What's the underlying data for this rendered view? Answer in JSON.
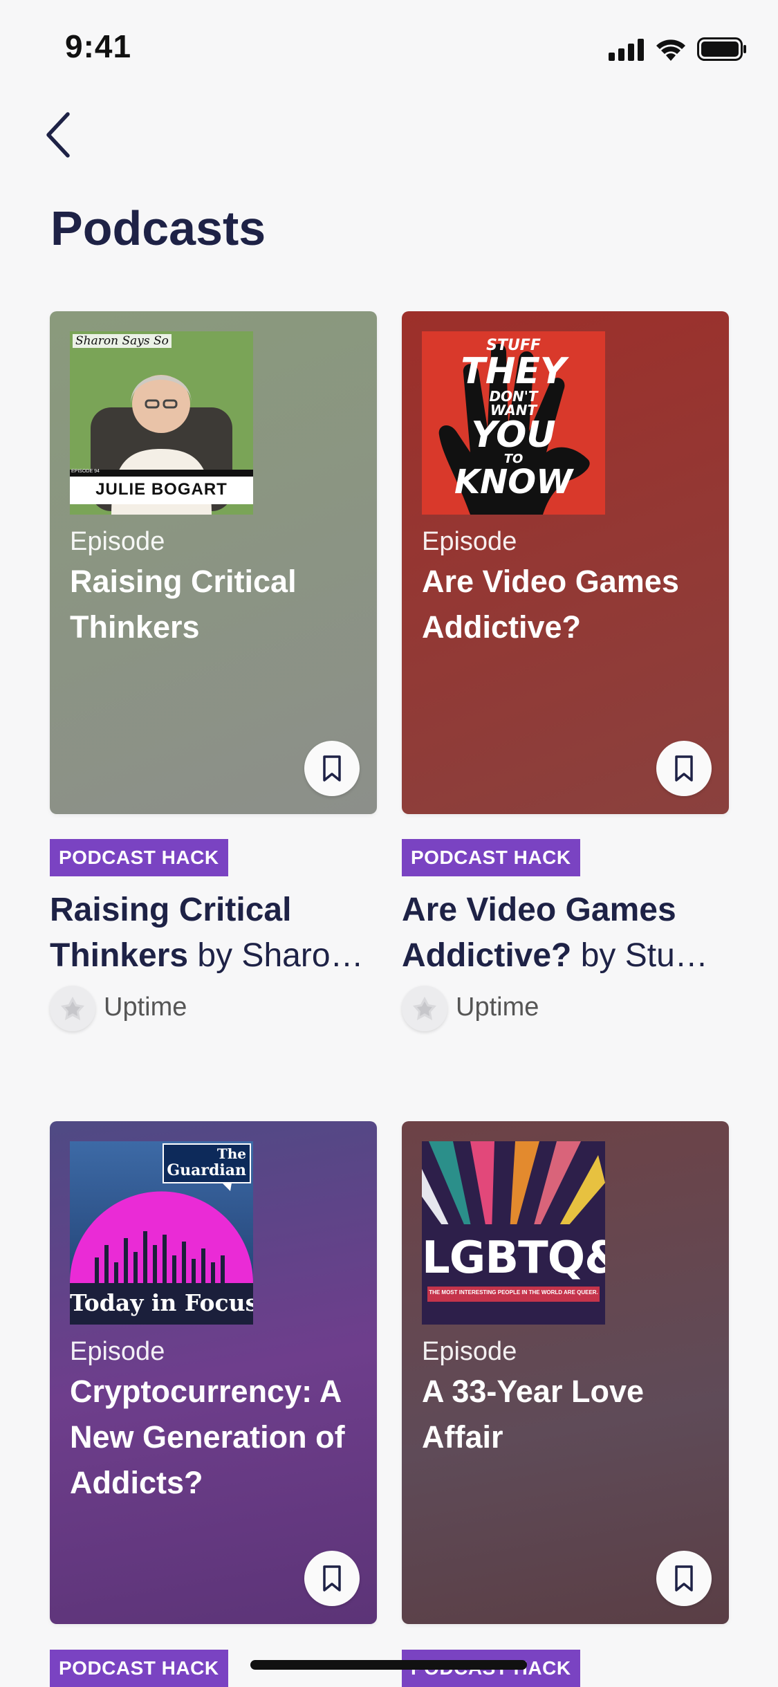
{
  "status_bar": {
    "time": "9:41"
  },
  "page": {
    "title": "Podcasts"
  },
  "cards": [
    {
      "episode_label": "Episode",
      "episode_title": "Raising Critical Thinkers",
      "bg_color": "#8a9282",
      "art": {
        "show_script_text": "Sharon Says So",
        "guest_name": "JULIE BOGART",
        "episode_tag": "EPISODE 94"
      },
      "badge": "PODCAST HACK",
      "title_bold_1": "Raising Critical",
      "title_bold_2": "Thinkers",
      "title_by": " by Sharo…",
      "source": "Uptime"
    },
    {
      "episode_label": "Episode",
      "episode_title": "Are Video Games Addictive?",
      "bg_color": "#9a3b35",
      "art": {
        "line1": "STUFF",
        "line2": "THEY",
        "line3": "DON'T",
        "line4": "WANT",
        "line5": "YOU",
        "line6": "TO",
        "line7": "KNOW"
      },
      "badge": "PODCAST HACK",
      "title_bold_1": "Are Video Games",
      "title_bold_2": "Addictive?",
      "title_by": " by Stu…",
      "source": "Uptime"
    },
    {
      "episode_label": "Episode",
      "episode_title": "Cryptocurrency: A New Generation of Addicts?",
      "bg_color": "#6b3f86",
      "art": {
        "brand_line1": "The",
        "brand_line2": "Guardian",
        "show_name": "Today in Focus"
      },
      "badge": "PODCAST HACK"
    },
    {
      "episode_label": "Episode",
      "episode_title": "A 33-Year Love Affair",
      "bg_color": "#5f4650",
      "art": {
        "show_name": "LGBTQ&A",
        "tagline": "THE MOST INTERESTING PEOPLE IN THE WORLD ARE QUEER."
      },
      "badge": "PODCAST HACK"
    }
  ],
  "icons": {
    "back": "chevron-left-icon",
    "bookmark": "bookmark-icon",
    "signal": "cellular-signal-icon",
    "wifi": "wifi-icon",
    "battery": "battery-icon",
    "source": "uptime-logo-icon"
  },
  "colors": {
    "title": "#1e2246",
    "badge": "#7a43c2",
    "background": "#f7f7f8"
  }
}
